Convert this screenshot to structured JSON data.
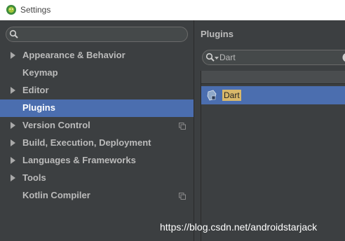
{
  "window": {
    "title": "Settings",
    "icon": "android-studio-icon"
  },
  "sidebar": {
    "search": {
      "value": "",
      "placeholder": ""
    },
    "items": [
      {
        "label": "Appearance & Behavior",
        "expandable": true,
        "project_icon": false
      },
      {
        "label": "Keymap",
        "expandable": false,
        "project_icon": false
      },
      {
        "label": "Editor",
        "expandable": true,
        "project_icon": false
      },
      {
        "label": "Plugins",
        "expandable": false,
        "project_icon": false,
        "selected": true
      },
      {
        "label": "Version Control",
        "expandable": true,
        "project_icon": true
      },
      {
        "label": "Build, Execution, Deployment",
        "expandable": true,
        "project_icon": false
      },
      {
        "label": "Languages & Frameworks",
        "expandable": true,
        "project_icon": false
      },
      {
        "label": "Tools",
        "expandable": true,
        "project_icon": false
      },
      {
        "label": "Kotlin Compiler",
        "expandable": false,
        "project_icon": true
      }
    ]
  },
  "plugins": {
    "title": "Plugins",
    "search_value": "Dart",
    "results": [
      {
        "name": "Dart",
        "icon": "plugin-icon",
        "selected": true
      }
    ]
  },
  "watermark": "https://blog.csdn.net/androidstarjack",
  "colors": {
    "background": "#3c3f41",
    "selection": "#4b6eaf",
    "text": "#bbbbbb",
    "highlight": "#d9b86a"
  }
}
